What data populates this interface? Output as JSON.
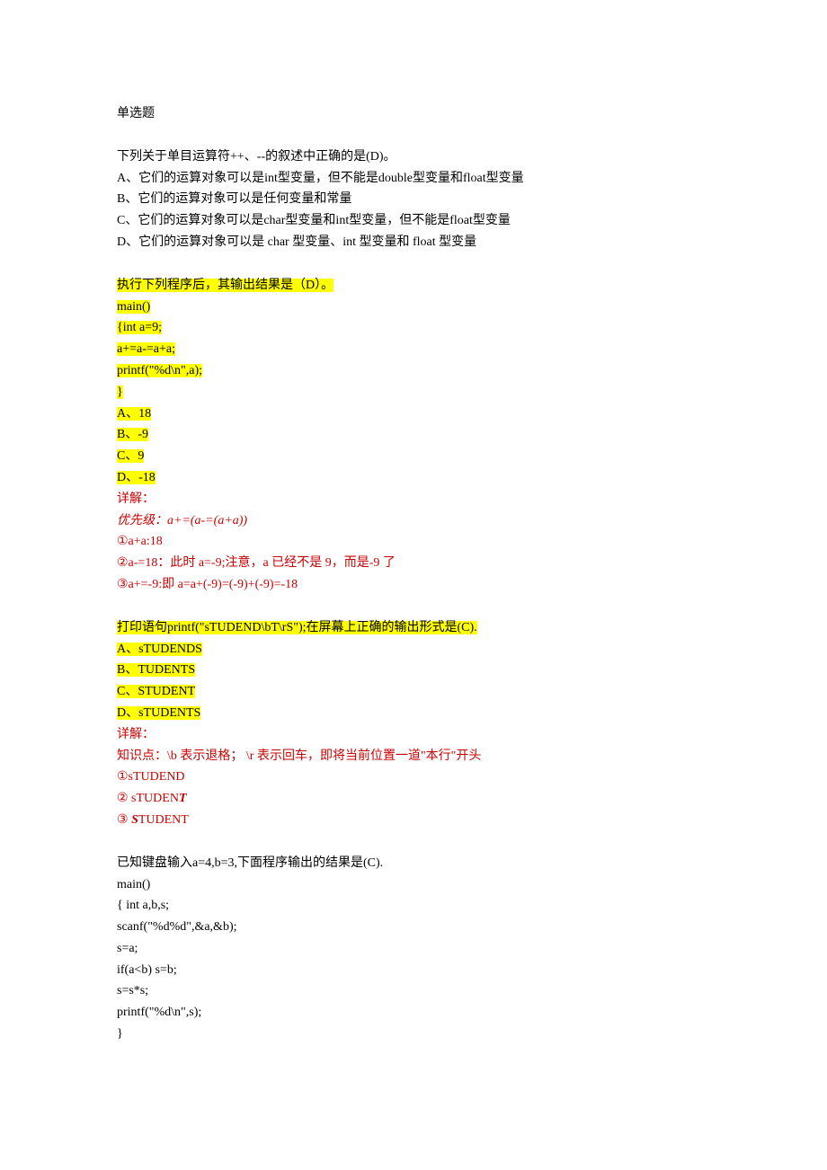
{
  "section_title": "单选题",
  "q1": {
    "stem": "下列关于单目运算符++、--的叙述中正确的是(D)。",
    "a": "A、它们的运算对象可以是int型变量，但不能是double型变量和float型变量",
    "b": "B、它们的运算对象可以是任何变量和常量",
    "c": "C、它们的运算对象可以是char型变量和int型变量，但不能是float型变量",
    "d": "D、它们的运算对象可以是 char 型变量、int 型变量和 float 型变量"
  },
  "q2": {
    "stem": "执行下列程序后，其输出结果是（D）。",
    "code1": "main()",
    "code2": "{int  a=9;",
    "code3": " a+=a-=a+a;",
    "code4": " printf(\"%d\\n\",a);",
    "code5": "}",
    "a": "A、18",
    "b": "B、-9",
    "c": "C、9",
    "d": "D、-18",
    "explain_label": "详解：",
    "e1": "优先级：a+=(a-=(a+a))",
    "e2": "①a+a:18",
    "e3": "②a-=18：此时 a=-9;注意，a 已经不是 9，而是-9 了",
    "e4": "③a+=-9:即 a=a+(-9)=(-9)+(-9)=-18"
  },
  "q3": {
    "stem": "打印语句printf(\"sTUDEND\\bT\\rS\");在屏幕上正确的输出形式是(C).",
    "a": "A、sTUDENDS",
    "b": "B、TUDENTS",
    "c": "C、STUDENT",
    "d": "D、sTUDENTS",
    "explain_label": "详解：",
    "e1": "知识点：\\b 表示退格；   \\r 表示回车，即将当前位置一道\"本行\"开头",
    "e2a": "①sTUDEND",
    "e3a": "② sTUDEN",
    "e3b": "T",
    "e4a": "③ ",
    "e4b": "S",
    "e4c": "TUDENT"
  },
  "q4": {
    "stem": "已知键盘输入a=4,b=3,下面程序输出的结果是(C).",
    "c1": "main()",
    "c2": "{ int a,b,s;",
    "c3": "  scanf(\"%d%d\",&a,&b);",
    "c4": "  s=a;",
    "c5": "  if(a<b) s=b;",
    "c6": "  s=s*s;",
    "c7": "  printf(\"%d\\n\",s);",
    "c8": "}"
  }
}
